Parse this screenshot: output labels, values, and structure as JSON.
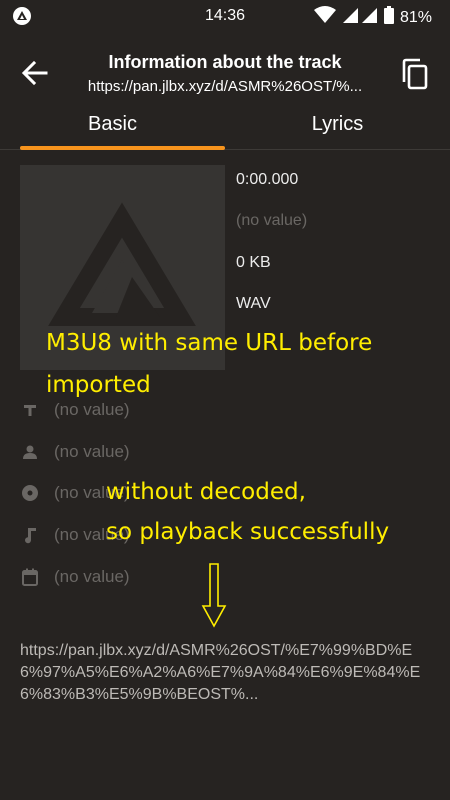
{
  "status_bar": {
    "time": "14:36",
    "battery": "81%",
    "notification_icon": "app-notification-icon",
    "wifi_icon": "wifi-icon",
    "signal_icon": "signal-icon",
    "battery_icon": "battery-icon"
  },
  "header": {
    "title": "Information about the track",
    "subtitle": "https://pan.jlbx.xyz/d/ASMR%26OST/%...",
    "back_icon": "arrow-back-icon",
    "copy_icon": "copy-icon"
  },
  "tabs": [
    {
      "label": "Basic",
      "active": true
    },
    {
      "label": "Lyrics",
      "active": false
    }
  ],
  "accent_color": "#f7941d",
  "track_info": {
    "duration": "0:00.000",
    "field_2": "(no value)",
    "size": "0 KB",
    "format": "WAV"
  },
  "metadata": [
    {
      "icon": "title-text-icon",
      "value": "(no value)"
    },
    {
      "icon": "artist-person-icon",
      "value": "(no value)"
    },
    {
      "icon": "album-disc-icon",
      "value": "(no value)"
    },
    {
      "icon": "genre-music-note-icon",
      "value": "(no value)"
    },
    {
      "icon": "calendar-icon",
      "value": "(no value)"
    }
  ],
  "annotations": {
    "line1": "M3U8 with same URL before",
    "line2": "imported",
    "line3": "without decoded,",
    "line4": "so playback successfully",
    "color": "#ffee00"
  },
  "full_url": "https://pan.jlbx.xyz/d/ASMR%26OST/%E7%99%BD%E6%97%A5%E6%A2%A6%E7%9A%84%E6%9E%84%E6%83%B3%E5%9B%BEOST%..."
}
